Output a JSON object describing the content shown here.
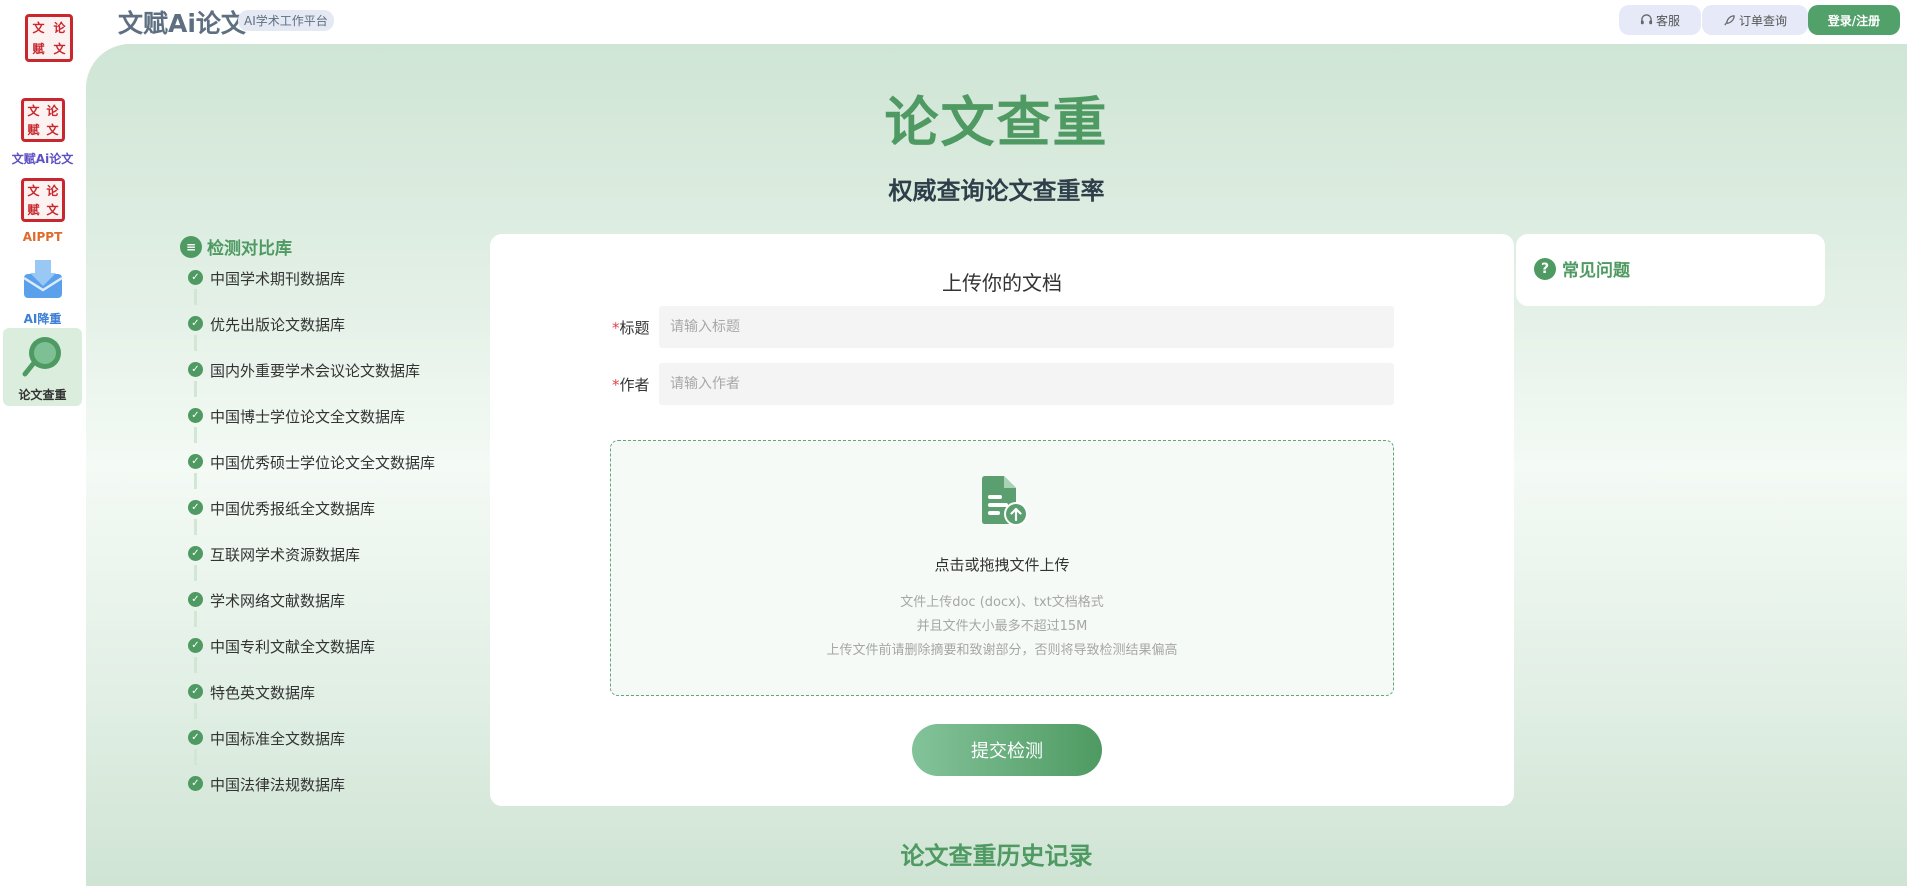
{
  "app": {
    "brand": "文赋Ai论文",
    "brand_sub": "AI学术工作平台",
    "logo_chars": [
      "文",
      "论",
      "赋",
      "文"
    ]
  },
  "header": {
    "service_label": "客服",
    "order_label": "订单查询",
    "login_label": "登录/注册"
  },
  "sidebar": {
    "items": [
      {
        "label": "文赋Ai论文",
        "color": "#5b4fc4"
      },
      {
        "label": "AIPPT",
        "color": "#e06a2a"
      },
      {
        "label": "AI降重",
        "color": "#3b7fd6"
      },
      {
        "label": "论文查重",
        "color": "#333333"
      }
    ]
  },
  "main": {
    "title": "论文查重",
    "subtitle": "权威查询论文查重率",
    "history_title": "论文查重历史记录"
  },
  "db": {
    "heading": "检测对比库",
    "items": [
      "中国学术期刊数据库",
      "优先出版论文数据库",
      "国内外重要学术会议论文数据库",
      "中国博士学位论文全文数据库",
      "中国优秀硕士学位论文全文数据库",
      "中国优秀报纸全文数据库",
      "互联网学术资源数据库",
      "学术网络文献数据库",
      "中国专利文献全文数据库",
      "特色英文数据库",
      "中国标准全文数据库",
      "中国法律法规数据库"
    ]
  },
  "upload": {
    "card_title": "上传你的文档",
    "required_mark": "*",
    "title_label": "标题",
    "title_placeholder": "请输入标题",
    "author_label": "作者",
    "author_placeholder": "请输入作者",
    "dropzone_text": "点击或拖拽文件上传",
    "hint_1": "文件上传doc (docx)、txt文档格式",
    "hint_2": "并且文件大小最多不超过15M",
    "hint_3": "上传文件前请删除摘要和致谢部分，否则将导致检测结果偏高",
    "submit_label": "提交检测"
  },
  "faq": {
    "title": "常见问题"
  },
  "colors": {
    "accent": "#4e9a62",
    "required": "#e2444b"
  }
}
